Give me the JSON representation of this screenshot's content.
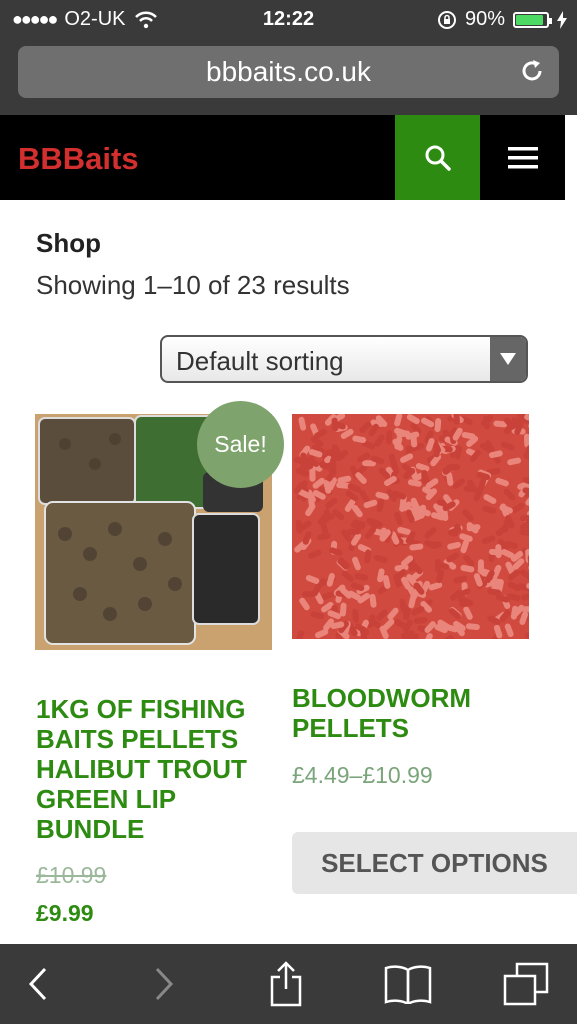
{
  "status_bar": {
    "carrier": "O2-UK",
    "time": "12:22",
    "battery_percent": "90%",
    "battery_level": 0.9
  },
  "browser": {
    "url": "bbbaits.co.uk"
  },
  "site": {
    "brand": "BBBaits"
  },
  "shop": {
    "title": "Shop",
    "result_count": "Showing 1–10 of 23 results",
    "sorting": "Default sorting"
  },
  "products": [
    {
      "title": "1KG OF FISHING BAITS PELLETS HALIBUT TROUT GREEN LIP BUNDLE",
      "badge": "Sale!",
      "old_price": "£10.99",
      "price": "£9.99"
    },
    {
      "title": "BLOODWORM PELLETS",
      "price": "£4.49–£10.99",
      "button_label": "SELECT OPTIONS"
    }
  ],
  "colors": {
    "brand_red": "#d32f2f",
    "accent_green": "#2e8b12",
    "sale_badge": "#7fa36c"
  }
}
